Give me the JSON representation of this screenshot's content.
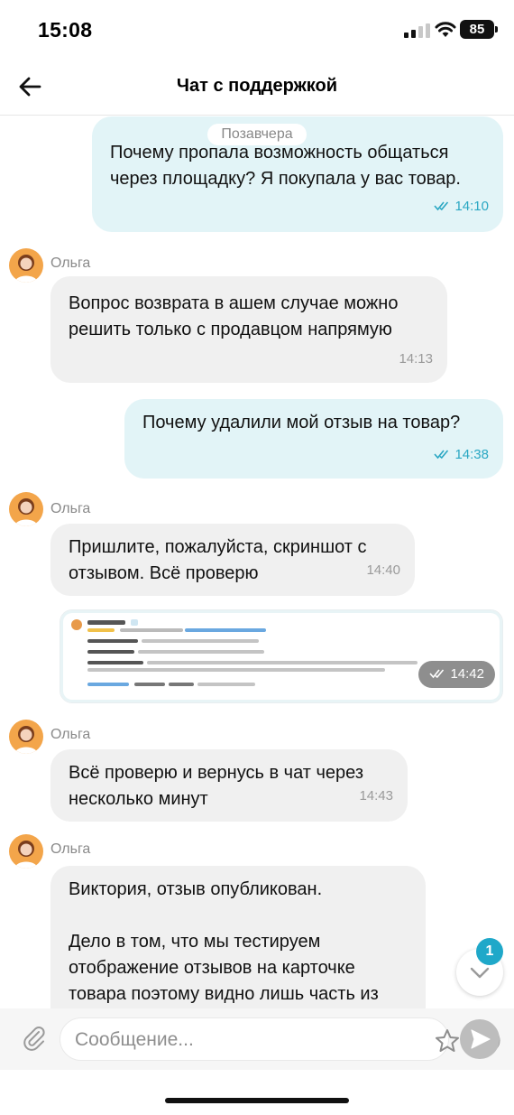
{
  "status_bar": {
    "time": "15:08",
    "battery": "85"
  },
  "header": {
    "title": "Чат с поддержкой"
  },
  "chat": {
    "date_label": "Позавчера",
    "messages": [
      {
        "dir": "out",
        "text_lines": [
          "Почему пропала возможность общаться",
          "через площадку? Я покупала у вас товар."
        ],
        "time": "14:10"
      },
      {
        "dir": "in",
        "sender": "Ольга",
        "text_lines": [
          "Вопрос возврата в ашем случае можно",
          "решить только с продавцом напрямую"
        ],
        "time": "14:13"
      },
      {
        "dir": "out",
        "text_lines": [
          "Почему удалили мой отзыв на товар?"
        ],
        "time": "14:38"
      },
      {
        "dir": "in",
        "sender": "Ольга",
        "text_lines": [
          "Пришлите, пожалуйста, скриншот с",
          "отзывом. Всё проверю"
        ],
        "time": "14:40"
      },
      {
        "dir": "out",
        "type": "image",
        "time": "14:42"
      },
      {
        "dir": "in",
        "sender": "Ольга",
        "text_lines": [
          "Всё проверю и вернусь в чат через",
          "несколько минут"
        ],
        "time": "14:43"
      },
      {
        "dir": "in",
        "sender": "Ольга",
        "text_lines": [
          "Виктория, отзыв опубликован.",
          "",
          "Дело в том, что мы тестируем",
          "отображение отзывов на карточке",
          "товара поэтому видно лишь часть из"
        ]
      }
    ],
    "unread_count": "1"
  },
  "composer": {
    "placeholder": "Сообщение..."
  },
  "colors": {
    "out_bubble": "#e2f4f7",
    "in_bubble": "#f0f0f0",
    "accent": "#1fa8c9"
  },
  "icons": [
    "back-arrow-icon",
    "clip-icon",
    "star-icon",
    "emoji-icon",
    "send-icon",
    "chevron-down-icon",
    "double-check-icon"
  ]
}
